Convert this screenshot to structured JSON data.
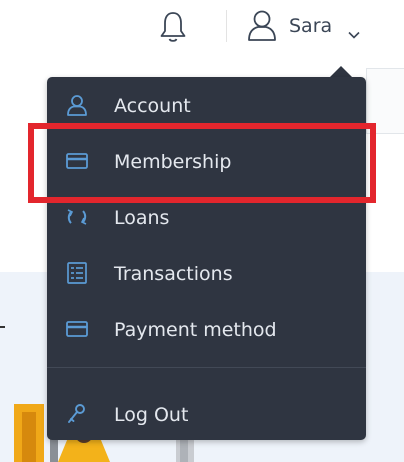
{
  "header": {
    "notifications_icon": "bell-icon",
    "user_icon": "user-icon",
    "user_name": "Sara",
    "dropdown_icon": "chevron-down-icon"
  },
  "menu": {
    "items": [
      {
        "label": "Account",
        "icon": "user-icon"
      },
      {
        "label": "Membership",
        "icon": "card-icon"
      },
      {
        "label": "Loans",
        "icon": "refresh-icon"
      },
      {
        "label": "Transactions",
        "icon": "list-icon"
      },
      {
        "label": "Payment method",
        "icon": "card-icon"
      },
      {
        "label": "Log Out",
        "icon": "key-icon"
      }
    ]
  },
  "colors": {
    "menu_bg": "#2f3541",
    "icon_blue": "#5b9bd5",
    "text": "#e4e8ee",
    "highlight": "#e3262d"
  }
}
